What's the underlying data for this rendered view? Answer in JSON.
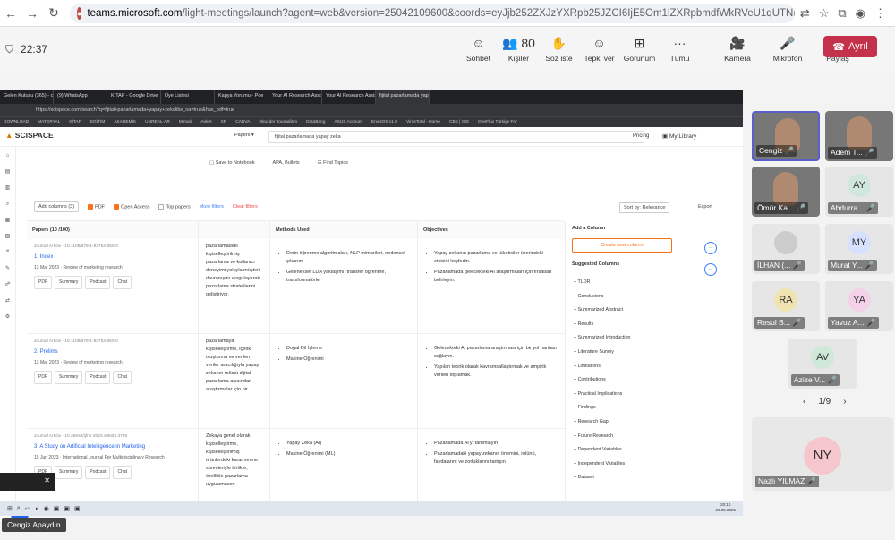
{
  "browser": {
    "url_site": "teams.microsoft.com",
    "url_rest": "/light-meetings/launch?agent=web&version=25042109600&coords=eyJjb252ZXJzYXRpb25JZCI6IjE5Om1lZXRpbmdfWkRVeU1qUTNPRFFF..."
  },
  "teams": {
    "timer": "22:37",
    "buttons": [
      {
        "label": "Sohbet",
        "icon": "chat-icon",
        "glyph": "☺"
      },
      {
        "label": "Kişiler",
        "icon": "people-icon",
        "glyph": "👥 80"
      },
      {
        "label": "Söz iste",
        "icon": "raise-hand-icon",
        "glyph": "✋"
      },
      {
        "label": "Tepki ver",
        "icon": "react-icon",
        "glyph": "☺"
      },
      {
        "label": "Görünüm",
        "icon": "view-icon",
        "glyph": "⊞"
      },
      {
        "label": "Tümü",
        "icon": "more-icon",
        "glyph": "···"
      },
      {
        "label": "Kamera",
        "icon": "camera-off-icon",
        "glyph": "🎥"
      },
      {
        "label": "Mikrofon",
        "icon": "mic-off-icon",
        "glyph": "🎤"
      },
      {
        "label": "Paylaş",
        "icon": "share-icon",
        "glyph": "⬆"
      }
    ],
    "leave_label": "Ayrıl",
    "presenter_label": "Cengiz Apaydın"
  },
  "shared": {
    "tabs": [
      "Gelen Kutusu (365) - cengiz",
      "(9) WhatsApp",
      "KİTAP - Google Drive",
      "Üye Listesi",
      "Kapya Yorumu - Poe",
      "Your AI Research Assistant",
      "Your AI Research Assistant",
      "fijital pazarlamada yapay"
    ],
    "address": "https://scispace.com/search?q=fijital+pazarlamada+yapay+zekalibs_oa=true&has_pdf=true",
    "bookmarks": [
      "DOWNLOAD",
      "MATERYAL",
      "KİTAP",
      "EGİTİM",
      "AKADEMİK",
      "UNREAL-AR",
      "Mimari",
      "Anket",
      "XR",
      "CANVA",
      "Okuzder Journalism",
      "DataBang",
      "ASUS Account",
      "EnvisOS v1.0",
      "VirusTotal - Home",
      "CBS | GIS",
      "OneFlux Türkiye For"
    ],
    "logo": "SCISPACE",
    "papers_dropdown": "Papers ▾",
    "query": "fijital pazarlamada yapay zeka",
    "pricing": "Pricing",
    "my_library": "My Library",
    "save_to_notebook": "Save to Notebook",
    "apa": "APA, Bullets",
    "find_topics": "Find Topics",
    "add_columns": "Add columns (3)",
    "pdf": "PDF",
    "open_access": "Open Access",
    "top_papers": "Top papers",
    "more_filters": "More filters",
    "clear_filters": "Clear filters",
    "sort": "Sort by: Relevance",
    "export": "Export",
    "col_papers": "Papers (10 /100)",
    "col_methods": "Methods Used",
    "col_objectives": "Objectives",
    "rows": [
      {
        "meta": "Journal Article · 10.1108/978-1-83753-350-0",
        "title": "1. Index",
        "date": "13 Mar 2023 · Review of marketing research",
        "insight": "pazarlamadaki kişiselleştirilmiş pazarlama ve kullanıcı deneyimi yoluyla müşteri davranışını vurgulayarak pazarlama stratejilerini geliştiriyor.",
        "methods": [
          "Derin öğrenme algoritmaları, NLP mimarileri, nedensel çıkarım",
          "Gelenekset LDA yaklaşımı, transfer öğrenme, transformatörler"
        ],
        "objectives": [
          "Yapay zekanın pazarlama ve tüketiciler üzerindeki etkisini keşfedin.",
          "Pazarlamada gelecekteki AI araştırmaları için fırsatları belirleyin."
        ]
      },
      {
        "meta": "Journal Article · 10.1108/978-1-83753-350-0",
        "title": "2. Prelims",
        "date": "13 Mar 2023 · Review of marketing research",
        "insight": "pazarlamaya kişiselleştirme, içerik oluşturma ve verilen veriler aracılığıyla yapay zekanın rolünü dijital pazarlama açısından araştırmalar için bir",
        "methods": [
          "Doğal Dil İşleme",
          "Makine Öğrenimi"
        ],
        "objectives": [
          "Gelecekteki AI pazarlama araştırması için bir yol haritası sağlayın.",
          "Yapılan teorik olarak kavramsallaştırmak ve ampirik verileri toplamak."
        ]
      },
      {
        "meta": "Journal Article · 10.36948/ijfmr.2023.v05i03.3789",
        "title": "3. A Study on Artificial Intelligence in Marketing",
        "date": "15 Jun 2023 · International Journal For Multidisciplinary Research",
        "insight": "Zekaya genel olarak kişiselleştirme, kişiselleştirilmiş ürünlerdeki karar verme süreçleriyle birlikte, özellikle pazarlama uygulamasını",
        "methods": [
          "Yapay Zeka (AI)",
          "Makine Öğrenimi (ML)"
        ],
        "objectives": [
          "Pazarlamada AI'yı tanımlayın",
          "Pazarlamadaki yapay zekanın önemini, rolünü, faydalarını ve zorluklarını tartışın"
        ]
      }
    ],
    "row_buttons": [
      "PDF",
      "Summary",
      "Podcast",
      "Chat"
    ],
    "add_column_title": "Add a Column",
    "create_new_column": "Create new column",
    "suggested_title": "Suggested Columns",
    "suggested": [
      "TLDR",
      "Conclusions",
      "Summarized Abstract",
      "Results",
      "Summarized Introduction",
      "Literature Survey",
      "Limitations",
      "Contributions",
      "Practical Implications",
      "Findings",
      "Research Gap",
      "Future Research",
      "Dependent Variables",
      "Independent Variables",
      "Dataset"
    ],
    "taskbar_time": "20:10",
    "taskbar_date": "23.05.2025"
  },
  "participants": [
    {
      "name": "Cengiz",
      "initials": "",
      "color": "#777777",
      "cam": true
    },
    {
      "name": "Adem T...",
      "initials": "",
      "color": "#888888",
      "cam": true
    },
    {
      "name": "Ömür Ka...",
      "initials": "",
      "color": "#999999",
      "cam": true
    },
    {
      "name": "Abdurra...",
      "initials": "AY",
      "color": "#d1e7dd"
    },
    {
      "name": "İLHAN (...",
      "initials": "",
      "color": "#cccccc"
    },
    {
      "name": "Murat Y...",
      "initials": "MY",
      "color": "#d8e0ff"
    },
    {
      "name": "Resul B...",
      "initials": "RA",
      "color": "#f1e3b0"
    },
    {
      "name": "Yavuz A...",
      "initials": "YA",
      "color": "#f3d1e8"
    },
    {
      "name": "Azize V...",
      "initials": "AV",
      "color": "#cfe8d8"
    }
  ],
  "pager": "1/9",
  "big_participant": {
    "name": "Nazlı YILMAZ",
    "initials": "NY"
  }
}
